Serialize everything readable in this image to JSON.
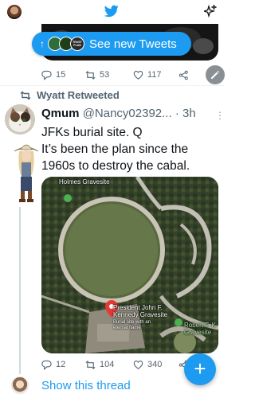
{
  "topbar": {
    "left_icon": "user-avatar",
    "center_icon": "twitter-bird-icon",
    "right_icon": "sparkle-icon"
  },
  "new_tweets_pill": {
    "label": "See new Tweets",
    "icon": "arrow-up-icon",
    "mini_avatar_caption": "TRUST PLAN"
  },
  "prev_tweet_actions": {
    "replies": "15",
    "retweets": "53",
    "likes": "117"
  },
  "retweet_header": {
    "label": "Wyatt Retweeted"
  },
  "tweet": {
    "name": "Qmum",
    "handle": "@Nancy02392...",
    "separator": " · ",
    "time": "3h",
    "text_lines": [
      "JFKs burial site. Q",
      "It’s been the plan since the",
      "1960s to destroy the cabal."
    ],
    "actions": {
      "replies": "12",
      "retweets": "104",
      "likes": "340"
    }
  },
  "map": {
    "label_holmes": "Holmes Gravesite",
    "label_jfk": [
      "President John F.",
      "Kennedy Gravesite"
    ],
    "label_jfk_sub": [
      "Burial site with an",
      "eternal flame"
    ],
    "label_robert": [
      "Robert F. K",
      "Gravesite"
    ]
  },
  "compose_button": "+",
  "show_thread": "Show this thread",
  "colors": {
    "accent": "#1d9bf0",
    "secondary_text": "#536471",
    "map_marker": "#e53935"
  }
}
